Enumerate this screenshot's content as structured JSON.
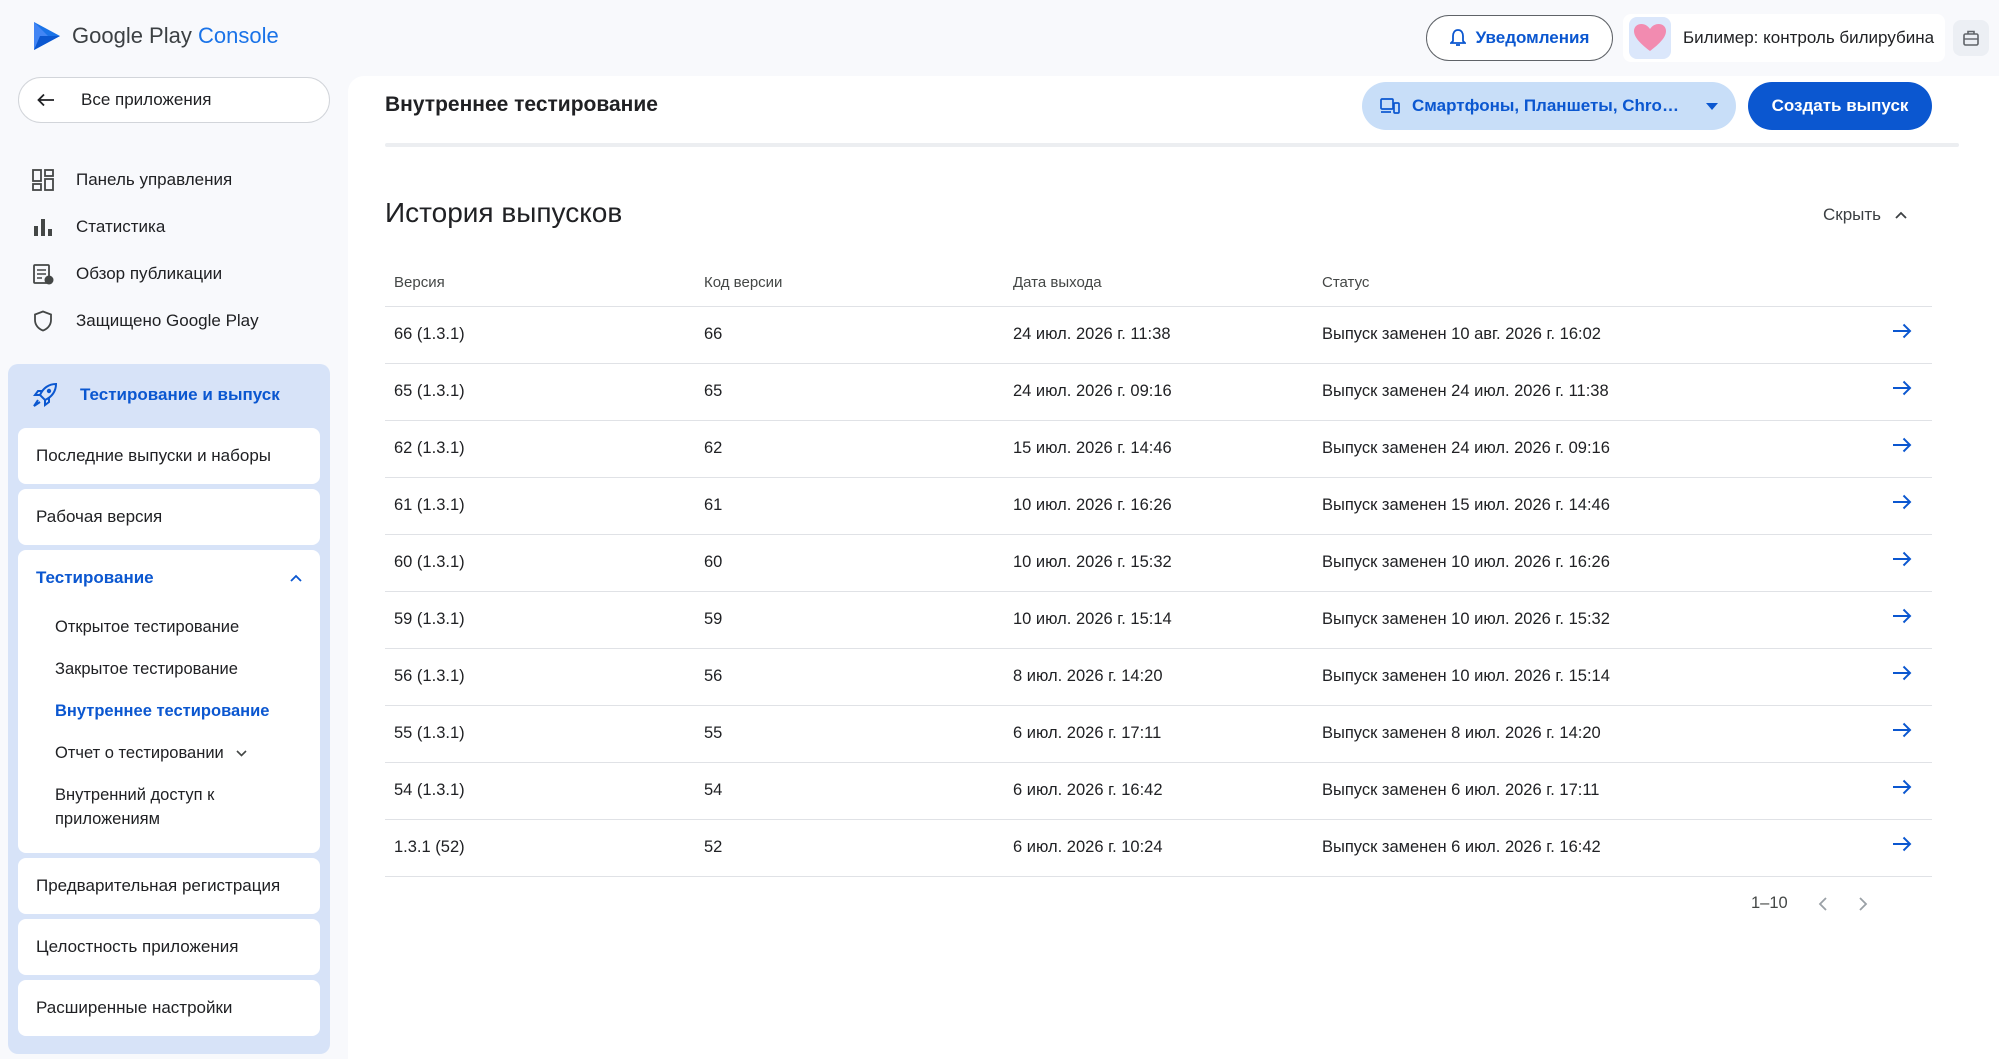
{
  "header": {
    "logo_text": "Google Play",
    "logo_accent": "Console",
    "notifications_label": "Уведомления",
    "app_name": "Билимер: контроль билирубина"
  },
  "sidebar": {
    "all_apps_label": "Все приложения",
    "main_items": [
      {
        "label": "Панель управления",
        "icon": "dashboard-icon"
      },
      {
        "label": "Статистика",
        "icon": "bar-chart-icon"
      },
      {
        "label": "Обзор публикации",
        "icon": "publishing-overview-icon"
      },
      {
        "label": "Защищено Google Play",
        "icon": "shield-icon"
      }
    ],
    "testing_section": {
      "label": "Тестирование и выпуск",
      "icon": "rocket-icon",
      "cards": [
        {
          "label": "Последние выпуски и наборы"
        },
        {
          "label": "Рабочая версия"
        },
        {
          "label": "Тестирование"
        },
        {
          "label": "Предварительная регистрация"
        },
        {
          "label": "Целостность приложения"
        },
        {
          "label": "Расширенные настройки"
        }
      ],
      "testing_subitems": [
        {
          "label": "Открытое тестирование"
        },
        {
          "label": "Закрытое тестирование"
        },
        {
          "label": "Внутреннее тестирование"
        },
        {
          "label": "Отчет о тестировании"
        },
        {
          "label": "Внутренний доступ к приложениям"
        }
      ]
    }
  },
  "main": {
    "page_title": "Внутреннее тестирование",
    "device_selector": "Смартфоны, Планшеты, Chrome O...",
    "create_release_label": "Создать выпуск",
    "section_title": "История выпусков",
    "hide_label": "Скрыть",
    "table": {
      "columns": [
        "Версия",
        "Код версии",
        "Дата выхода",
        "Статус"
      ],
      "rows": [
        {
          "version": "66 (1.3.1)",
          "code": "66",
          "date": "24 июл. 2026 г. 11:38",
          "status": "Выпуск заменен 10 авг. 2026 г. 16:02"
        },
        {
          "version": "65 (1.3.1)",
          "code": "65",
          "date": "24 июл. 2026 г. 09:16",
          "status": "Выпуск заменен 24 июл. 2026 г. 11:38"
        },
        {
          "version": "62 (1.3.1)",
          "code": "62",
          "date": "15 июл. 2026 г. 14:46",
          "status": "Выпуск заменен 24 июл. 2026 г. 09:16"
        },
        {
          "version": "61 (1.3.1)",
          "code": "61",
          "date": "10 июл. 2026 г. 16:26",
          "status": "Выпуск заменен 15 июл. 2026 г. 14:46"
        },
        {
          "version": "60 (1.3.1)",
          "code": "60",
          "date": "10 июл. 2026 г. 15:32",
          "status": "Выпуск заменен 10 июл. 2026 г. 16:26"
        },
        {
          "version": "59 (1.3.1)",
          "code": "59",
          "date": "10 июл. 2026 г. 15:14",
          "status": "Выпуск заменен 10 июл. 2026 г. 15:32"
        },
        {
          "version": "56 (1.3.1)",
          "code": "56",
          "date": "8 июл. 2026 г. 14:20",
          "status": "Выпуск заменен 10 июл. 2026 г. 15:14"
        },
        {
          "version": "55 (1.3.1)",
          "code": "55",
          "date": "6 июл. 2026 г. 17:11",
          "status": "Выпуск заменен 8 июл. 2026 г. 14:20"
        },
        {
          "version": "54 (1.3.1)",
          "code": "54",
          "date": "6 июл. 2026 г. 16:42",
          "status": "Выпуск заменен 6 июл. 2026 г. 17:11"
        },
        {
          "version": "1.3.1 (52)",
          "code": "52",
          "date": "6 июл. 2026 г. 10:24",
          "status": "Выпуск заменен 6 июл. 2026 г. 16:42"
        }
      ]
    },
    "pagination": {
      "range": "1–10"
    }
  },
  "colors": {
    "accent": "#0b57d0",
    "sidebar_active_bg": "#d7e3f8",
    "device_btn_bg": "#c8def8"
  }
}
